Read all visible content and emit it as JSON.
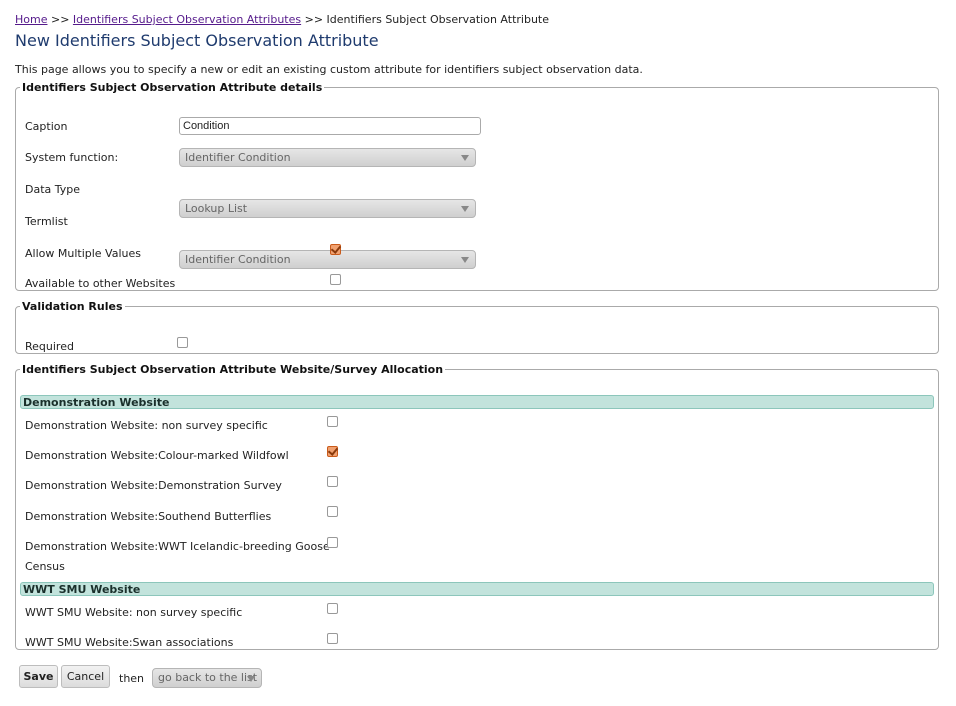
{
  "breadcrumb": {
    "home": "Home",
    "sep1": " >> ",
    "list": "Identifiers Subject Observation Attributes",
    "sep2": " >> ",
    "current": "Identifiers Subject Observation Attribute"
  },
  "page_title": "New Identifiers Subject Observation Attribute",
  "intro": "This page allows you to specify a new or edit an existing custom attribute for identifiers subject observation data.",
  "details": {
    "legend": "Identifiers Subject Observation Attribute details",
    "caption_label": "Caption",
    "caption_value": "Condition",
    "system_function_label": "System function:",
    "system_function_value": "Identifier Condition",
    "data_type_label": "Data Type",
    "data_type_value": "Lookup List",
    "termlist_label": "Termlist",
    "termlist_value": "Identifier Condition",
    "allow_multiple_label": "Allow Multiple Values",
    "allow_multiple_checked": true,
    "available_label": "Available to other Websites",
    "available_checked": false
  },
  "validation": {
    "legend": "Validation Rules",
    "required_label": "Required",
    "required_checked": false
  },
  "allocation": {
    "legend": "Identifiers Subject Observation Attribute Website/Survey Allocation",
    "groups": [
      {
        "name": "Demonstration Website",
        "items": [
          {
            "label": "Demonstration Website: non survey specific",
            "checked": false
          },
          {
            "label": "Demonstration Website:Colour-marked Wildfowl",
            "checked": true
          },
          {
            "label": "Demonstration Website:Demonstration Survey",
            "checked": false
          },
          {
            "label": "Demonstration Website:Southend Butterflies",
            "checked": false
          },
          {
            "label": "Demonstration Website:WWT Icelandic-breeding Goose",
            "label2": "Census",
            "checked": false
          }
        ]
      },
      {
        "name": "WWT SMU Website",
        "items": [
          {
            "label": "WWT SMU Website: non survey specific",
            "checked": false
          },
          {
            "label": "WWT SMU Website:Swan associations",
            "checked": false
          }
        ]
      }
    ]
  },
  "footer": {
    "save_label": "Save",
    "cancel_label": "Cancel",
    "then_label": "then",
    "after_action": "go back to the list"
  }
}
